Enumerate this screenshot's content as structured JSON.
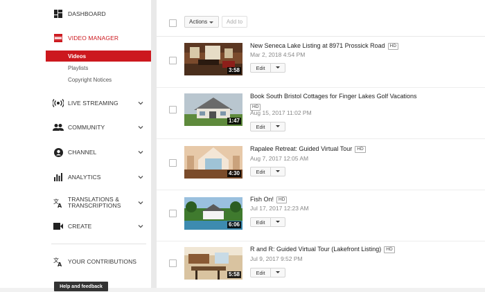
{
  "sidebar": {
    "dashboard": "DASHBOARD",
    "video_manager": "VIDEO MANAGER",
    "sub_items": [
      "Videos",
      "Playlists",
      "Copyright Notices"
    ],
    "live_streaming": "LIVE STREAMING",
    "community": "COMMUNITY",
    "channel": "CHANNEL",
    "analytics": "ANALYTICS",
    "translations_line1": "TRANSLATIONS &",
    "translations_line2": "TRANSCRIPTIONS",
    "create": "CREATE",
    "your_contributions": "YOUR CONTRIBUTIONS",
    "help_feedback": "Help and feedback"
  },
  "toolbar": {
    "actions_label": "Actions",
    "add_to_label": "Add to"
  },
  "videos": [
    {
      "title": "New Seneca Lake Listing at 8971 Prossick Road",
      "hd": "HD",
      "date": "Mar 2, 2018 4:54 PM",
      "duration": "3:58",
      "edit": "Edit"
    },
    {
      "title": "Book South Bristol Cottages for Finger Lakes Golf Vacations",
      "hd": "HD",
      "date": "Aug 15, 2017 11:02 PM",
      "duration": "1:47",
      "edit": "Edit"
    },
    {
      "title": "Rapalee Retreat: Guided Virtual Tour",
      "hd": "HD",
      "date": "Aug 7, 2017 12:05 AM",
      "duration": "4:30",
      "edit": "Edit"
    },
    {
      "title": "Fish On!",
      "hd": "HD",
      "date": "Jul 17, 2017 12:23 AM",
      "duration": "6:06",
      "edit": "Edit"
    },
    {
      "title": "R and R: Guided Virtual Tour (Lakefront Listing)",
      "hd": "HD",
      "date": "Jul 9, 2017 9:52 PM",
      "duration": "5:58",
      "edit": "Edit"
    }
  ],
  "colors": {
    "accent": "#cc181e"
  }
}
